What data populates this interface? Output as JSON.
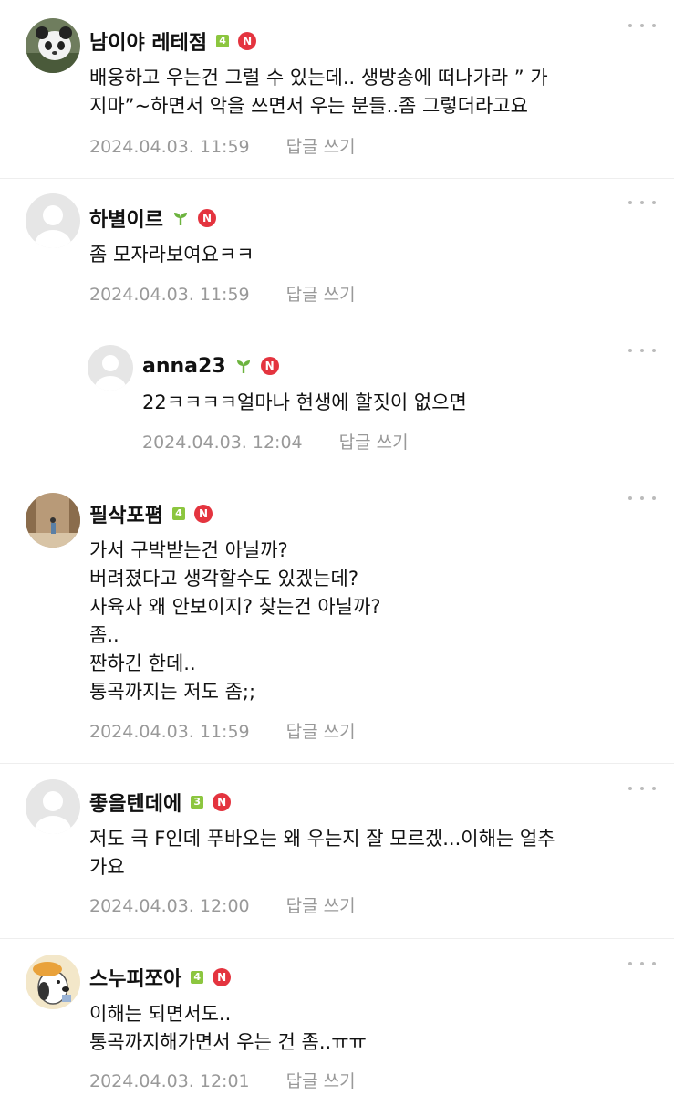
{
  "comments": [
    {
      "author": "남이야 레테점",
      "level": "4",
      "badge": "N",
      "lines": [
        "배웅하고 우는건 그럴 수 있는데.. 생방송에 떠나가라 ” 가",
        "지마”~하면서 악을 쓰면서 우는 분들..좀 그렇더라고요"
      ],
      "date": "2024.04.03. 11:59",
      "reply_label": "답글 쓰기"
    },
    {
      "author": "하별이르",
      "level": "sprout",
      "badge": "N",
      "lines": [
        "좀 모자라보여요ㅋㅋ"
      ],
      "date": "2024.04.03. 11:59",
      "reply_label": "답글 쓰기"
    },
    {
      "author": "anna23",
      "level": "sprout",
      "badge": "N",
      "lines": [
        "22ㅋㅋㅋㅋ얼마나 현생에 할짓이 없으면"
      ],
      "date": "2024.04.03. 12:04",
      "reply_label": "답글 쓰기"
    },
    {
      "author": "필삭포폄",
      "level": "4",
      "badge": "N",
      "lines": [
        "가서 구박받는건 아닐까?",
        "버려졌다고 생각할수도 있겠는데?",
        "사육사 왜 안보이지? 찾는건 아닐까?",
        "좀..",
        "짠하긴 한데..",
        "통곡까지는 저도 좀;;"
      ],
      "date": "2024.04.03. 11:59",
      "reply_label": "답글 쓰기"
    },
    {
      "author": "좋을텐데에",
      "level": "3",
      "badge": "N",
      "lines": [
        "저도 극 F인데 푸바오는 왜 우는지 잘 모르겠...이해는 얼추",
        "가요"
      ],
      "date": "2024.04.03. 12:00",
      "reply_label": "답글 쓰기"
    },
    {
      "author": "스누피쪼아",
      "level": "4",
      "badge": "N",
      "lines": [
        "이해는 되면서도..",
        "통곡까지해가면서 우는 건 좀..ㅠㅠ"
      ],
      "date": "2024.04.03. 12:01",
      "reply_label": "답글 쓰기"
    }
  ],
  "colors": {
    "level_badge": "#8cc63f",
    "n_badge": "#e4343f",
    "meta_text": "#999999"
  }
}
